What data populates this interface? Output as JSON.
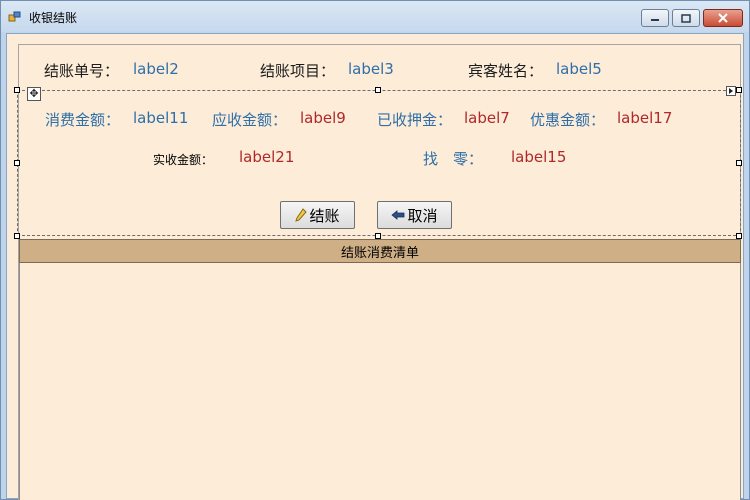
{
  "window": {
    "title": "收银结账",
    "icon": "app-window-icon",
    "controls": [
      "minimize-icon",
      "maximize-icon",
      "close-icon"
    ]
  },
  "header_row": {
    "bill_no_label": "结账单号：",
    "bill_no_value": "label2",
    "item_label": "结账项目：",
    "item_value": "label3",
    "guest_label": "宾客姓名：",
    "guest_value": "label5"
  },
  "amounts_row": {
    "consumption_label": "消费金额：",
    "consumption_value": "label11",
    "receivable_label": "应收金额：",
    "receivable_value": "label9",
    "deposit_label": "已收押金：",
    "deposit_value": "label7",
    "discount_label": "优惠金额：",
    "discount_value": "label17"
  },
  "paid_row": {
    "actual_label": "实收金额：",
    "actual_value": "label21",
    "change_label": "找　零：",
    "change_value": "label15"
  },
  "buttons": {
    "checkout_label": "结账",
    "cancel_label": "取消"
  },
  "grid": {
    "header": "结账消费清单"
  },
  "colors": {
    "background": "#fcecd8",
    "grid_header": "#cfaf86",
    "blue_text": "#2e6fa8",
    "red_text": "#b0282a"
  }
}
